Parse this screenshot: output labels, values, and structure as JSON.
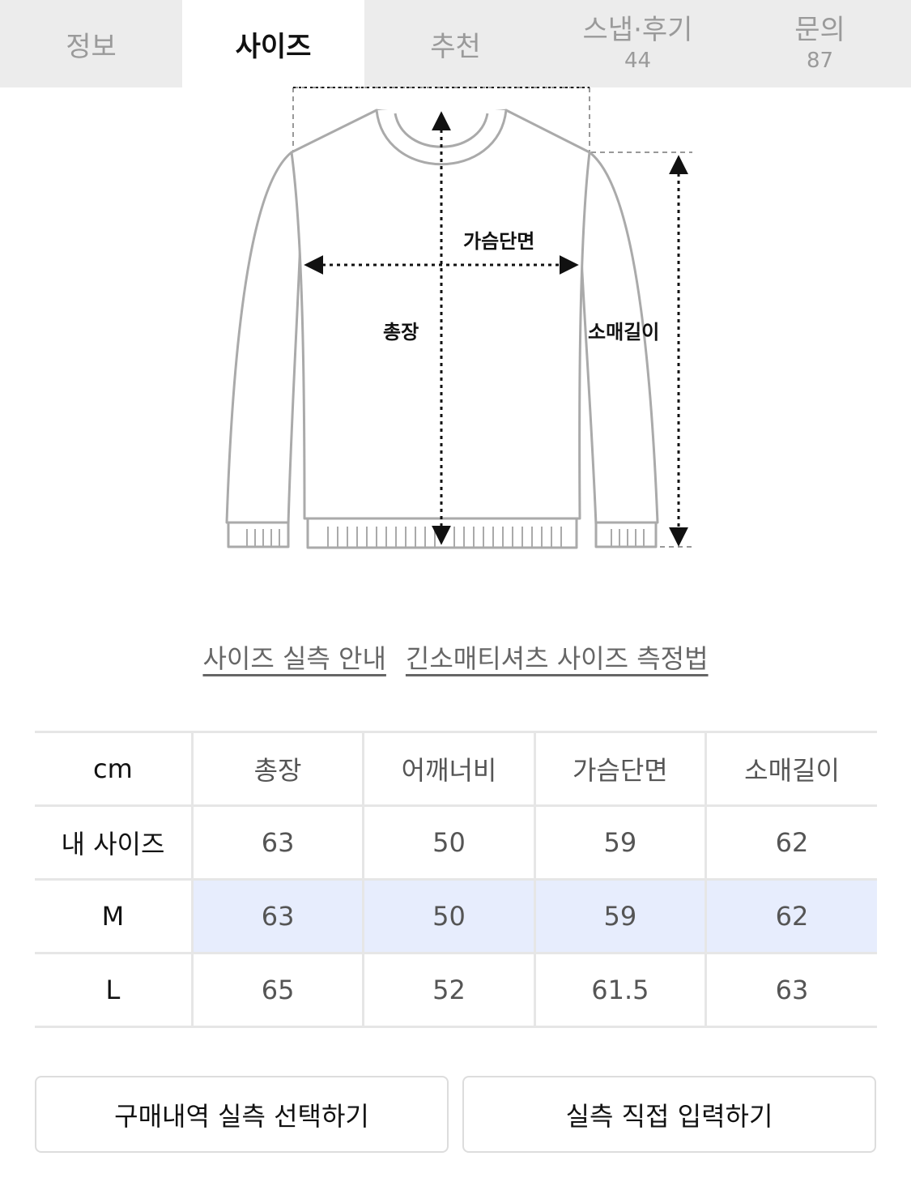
{
  "tabs": [
    {
      "label": "정보",
      "count": null
    },
    {
      "label": "사이즈",
      "count": null
    },
    {
      "label": "추천",
      "count": null
    },
    {
      "label": "스냅·후기",
      "count": "44"
    },
    {
      "label": "문의",
      "count": "87"
    }
  ],
  "active_tab": "사이즈",
  "diagram": {
    "chest_label": "가슴단면",
    "length_label": "총장",
    "sleeve_label": "소매길이"
  },
  "links": {
    "guide": "사이즈 실측 안내",
    "method": "긴소매티셔츠 사이즈 측정법"
  },
  "table": {
    "unit": "cm",
    "headers": [
      "총장",
      "어깨너비",
      "가슴단면",
      "소매길이"
    ],
    "rows": [
      {
        "label": "내 사이즈",
        "values": [
          "63",
          "50",
          "59",
          "62"
        ],
        "highlight": false
      },
      {
        "label": "M",
        "values": [
          "63",
          "50",
          "59",
          "62"
        ],
        "highlight": true
      },
      {
        "label": "L",
        "values": [
          "65",
          "52",
          "61.5",
          "63"
        ],
        "highlight": false
      }
    ]
  },
  "colors": {
    "highlight_row": "#e7edfd",
    "tab_bar": "#ececec"
  },
  "buttons": {
    "purchase_history": "구매내역 실측 선택하기",
    "direct_input": "실측 직접 입력하기"
  }
}
